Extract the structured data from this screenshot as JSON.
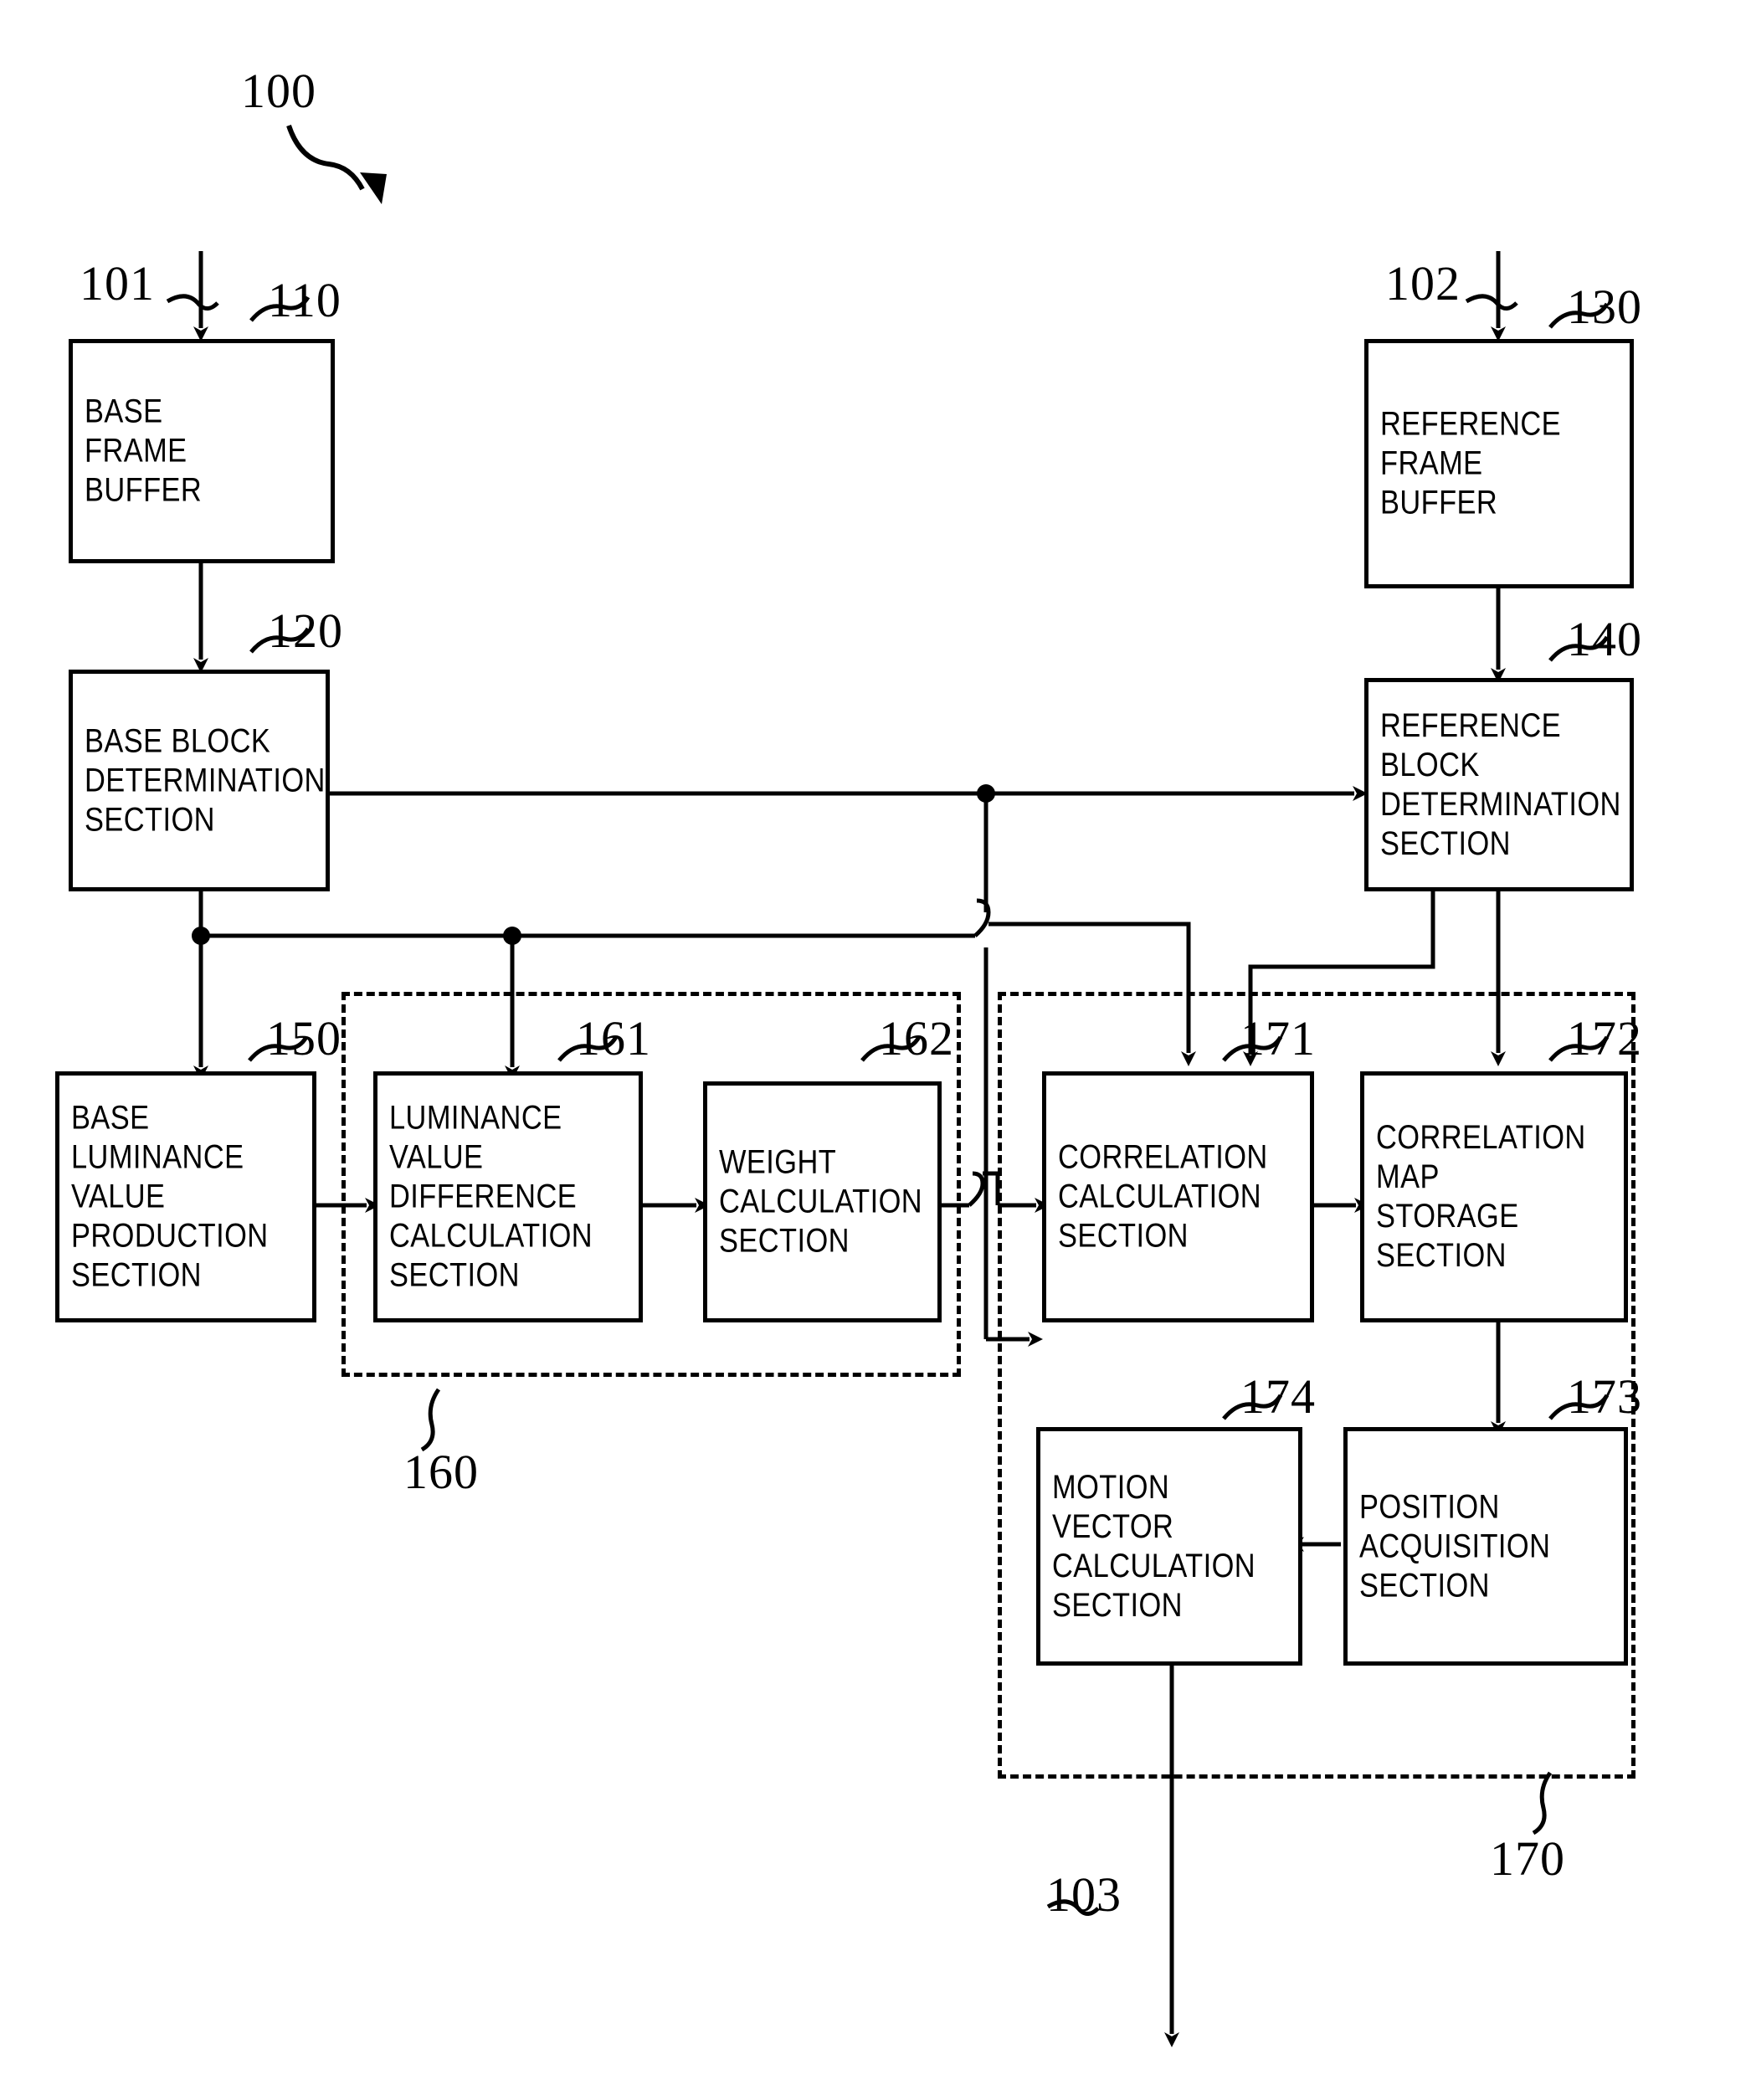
{
  "figure": {
    "system_numeral": "100",
    "inputs": [
      {
        "id": "101",
        "label": "101"
      },
      {
        "id": "102",
        "label": "102"
      }
    ],
    "output": {
      "id": "103",
      "label": "103"
    }
  },
  "blocks": [
    {
      "key": "base_frame_buffer",
      "numeral": "110",
      "text": "BASE\nFRAME\nBUFFER"
    },
    {
      "key": "base_block_det",
      "numeral": "120",
      "text": "BASE BLOCK\nDETERMINATION\nSECTION"
    },
    {
      "key": "reference_frame_buffer",
      "numeral": "130",
      "text": "REFERENCE\nFRAME\nBUFFER"
    },
    {
      "key": "reference_block_det",
      "numeral": "140",
      "text": "REFERENCE\nBLOCK\nDETERMINATION\nSECTION"
    },
    {
      "key": "base_lum_prod",
      "numeral": "150",
      "text": "BASE\nLUMINANCE\nVALUE\nPRODUCTION\nSECTION"
    },
    {
      "key": "lum_diff_calc",
      "numeral": "161",
      "text": "LUMINANCE\nVALUE\nDIFFERENCE\nCALCULATION\nSECTION"
    },
    {
      "key": "weight_calc",
      "numeral": "162",
      "text": "WEIGHT\nCALCULATION\nSECTION"
    },
    {
      "key": "corr_calc",
      "numeral": "171",
      "text": "CORRELATION\nCALCULATION\nSECTION"
    },
    {
      "key": "corr_map_storage",
      "numeral": "172",
      "text": "CORRELATION\nMAP STORAGE\nSECTION"
    },
    {
      "key": "position_acq",
      "numeral": "173",
      "text": "POSITION\nACQUISITION\nSECTION"
    },
    {
      "key": "motion_vector_calc",
      "numeral": "174",
      "text": "MOTION\nVECTOR\nCALCULATION\nSECTION"
    }
  ],
  "groups": [
    {
      "key": "weight_group",
      "numeral": "160"
    },
    {
      "key": "correlation_group",
      "numeral": "170"
    }
  ],
  "colors": {
    "line": "#000000",
    "background": "#ffffff"
  }
}
